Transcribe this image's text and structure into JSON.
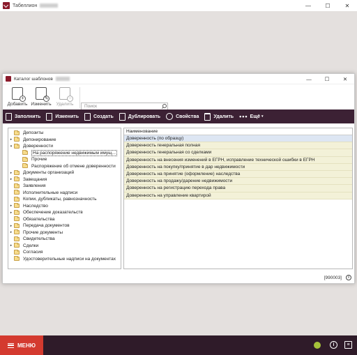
{
  "app": {
    "title": "Табеллион",
    "minimize": "—",
    "maximize": "☐",
    "close": "✕"
  },
  "dialog": {
    "title": "Каталог шаблонов",
    "minimize": "—",
    "maximize": "☐",
    "close": "✕",
    "toolbar": {
      "add_label": "Добавить",
      "edit_label": "Изменить",
      "delete_label": "Удалить",
      "search_placeholder": "Поиск"
    },
    "actions": {
      "fill": "Заполнить",
      "change": "Изменить",
      "create": "Создать",
      "duplicate": "Дублировать",
      "properties": "Свойства",
      "delete": "Удалить",
      "more": "Ещё"
    },
    "tree": [
      {
        "label": "Депозиты",
        "expander": ""
      },
      {
        "label": "Депонирование",
        "expander": "▸"
      },
      {
        "label": "Доверенности",
        "expander": "▾"
      },
      {
        "label": "На распоряжение недвижимым имущ...",
        "expander": "",
        "selected": true,
        "child": true
      },
      {
        "label": "Прочие",
        "expander": "",
        "child": true
      },
      {
        "label": "Распоряжение об отмене доверенности",
        "expander": "",
        "child": true
      },
      {
        "label": "Документы организаций",
        "expander": "▸"
      },
      {
        "label": "Завещания",
        "expander": "▸"
      },
      {
        "label": "Заявления",
        "expander": ""
      },
      {
        "label": "Исполнительные надписи",
        "expander": ""
      },
      {
        "label": "Копии, дубликаты, равнозначность",
        "expander": ""
      },
      {
        "label": "Наследство",
        "expander": "▸"
      },
      {
        "label": "Обеспечение доказательств",
        "expander": "▸"
      },
      {
        "label": "Обязательства",
        "expander": ""
      },
      {
        "label": "Передача документов",
        "expander": "▸"
      },
      {
        "label": "Прочие документы",
        "expander": "▸"
      },
      {
        "label": "Свидетельства",
        "expander": ""
      },
      {
        "label": "Сделки",
        "expander": "▸"
      },
      {
        "label": "Согласия",
        "expander": ""
      },
      {
        "label": "Удостоверительные надписи на документах",
        "expander": ""
      }
    ],
    "list": {
      "header": "Наименование",
      "rows": [
        "Доверенность (по образцу)",
        "Доверенность генеральная полная",
        "Доверенность генеральная со сделками",
        "Доверенность на внесения изменений в ЕГРН, исправление технической ошибки в ЕГРН",
        "Доверенность на покупку/принятие в дар недвижимости",
        "Доверенность на принятие (оформление) наследства",
        "Доверенность на продажу/дарение недвижимости",
        "Доверенность на регистрацию перехода права",
        "Доверенность на управление квартирой"
      ]
    },
    "status_code": "[990003]",
    "info": "i"
  },
  "bottom": {
    "menu_label": "МЕНЮ",
    "info": "i"
  },
  "colors": {
    "accent": "#3c2134",
    "menu": "#d43a2f",
    "status_ok": "#a6c23a"
  }
}
